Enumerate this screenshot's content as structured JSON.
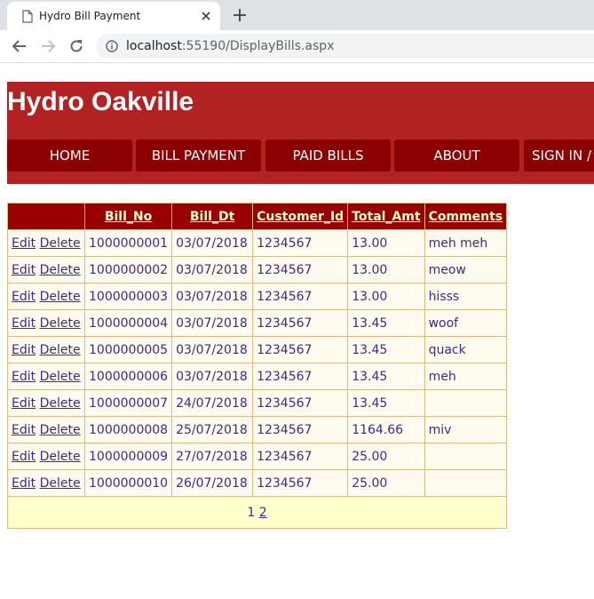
{
  "browser": {
    "tab_title": "Hydro Bill Payment",
    "url_host": "localhost",
    "url_rest": ":55190/DisplayBills.aspx"
  },
  "site": {
    "title": "Hydro Oakville",
    "menu": [
      "HOME",
      "BILL PAYMENT",
      "PAID BILLS",
      "ABOUT",
      "SIGN IN /"
    ],
    "colors": {
      "header": "#b22222",
      "menu_button": "#8b0000",
      "grid_header": "#990000",
      "pager": "#ffffcc"
    }
  },
  "grid": {
    "columns": [
      "Bill_No",
      "Bill_Dt",
      "Customer_Id",
      "Total_Amt",
      "Comments"
    ],
    "edit_label": "Edit",
    "delete_label": "Delete",
    "rows": [
      [
        "1000000001",
        "03/07/2018",
        "1234567",
        "13.00",
        "meh meh"
      ],
      [
        "1000000002",
        "03/07/2018",
        "1234567",
        "13.00",
        "meow"
      ],
      [
        "1000000003",
        "03/07/2018",
        "1234567",
        "13.00",
        "hisss"
      ],
      [
        "1000000004",
        "03/07/2018",
        "1234567",
        "13.45",
        "woof"
      ],
      [
        "1000000005",
        "03/07/2018",
        "1234567",
        "13.45",
        "quack"
      ],
      [
        "1000000006",
        "03/07/2018",
        "1234567",
        "13.45",
        "meh"
      ],
      [
        "1000000007",
        "24/07/2018",
        "1234567",
        "13.45",
        ""
      ],
      [
        "1000000008",
        "25/07/2018",
        "1234567",
        "1164.66",
        "miv"
      ],
      [
        "1000000009",
        "27/07/2018",
        "1234567",
        "25.00",
        ""
      ],
      [
        "1000000010",
        "26/07/2018",
        "1234567",
        "25.00",
        ""
      ]
    ],
    "pager": {
      "current": "1",
      "pages": [
        "2"
      ]
    }
  }
}
